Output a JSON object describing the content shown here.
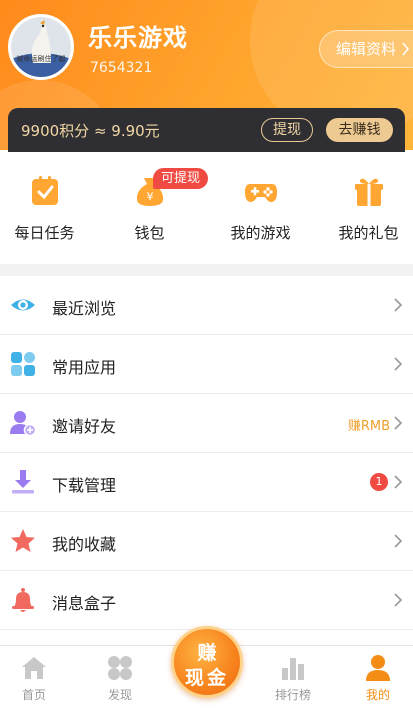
{
  "header": {
    "avatar_caption": "被命运刷住了腿",
    "nickname": "乐乐游戏",
    "user_id": "7654321",
    "edit_label": "编辑资料",
    "accent_color": "#ff8a1c"
  },
  "points": {
    "text": "9900积分 ≈ 9.90元",
    "withdraw_label": "提现",
    "earn_label": "去赚钱"
  },
  "quick": {
    "items": [
      {
        "label": "每日任务",
        "icon": "clipboard-check-icon"
      },
      {
        "label": "钱包",
        "icon": "money-bag-icon"
      },
      {
        "label": "我的游戏",
        "icon": "gamepad-icon"
      },
      {
        "label": "我的礼包",
        "icon": "gift-icon"
      }
    ],
    "wallet_badge": "可提现"
  },
  "list": {
    "items": [
      {
        "label": "最近浏览",
        "icon": "eye-icon"
      },
      {
        "label": "常用应用",
        "icon": "apps-grid-icon"
      },
      {
        "label": "邀请好友",
        "icon": "add-user-icon",
        "tip": "赚RMB"
      },
      {
        "label": "下载管理",
        "icon": "download-icon",
        "badge": "1"
      },
      {
        "label": "我的收藏",
        "icon": "star-icon"
      },
      {
        "label": "消息盒子",
        "icon": "bell-icon"
      }
    ]
  },
  "tabbar": {
    "items": [
      {
        "label": "首页",
        "icon": "home-icon"
      },
      {
        "label": "发现",
        "icon": "discover-icon"
      },
      {
        "label": "排行榜",
        "icon": "ranking-icon"
      },
      {
        "label": "我的",
        "icon": "profile-icon",
        "active": true
      }
    ],
    "center_line1": "赚",
    "center_line2": "现金"
  }
}
